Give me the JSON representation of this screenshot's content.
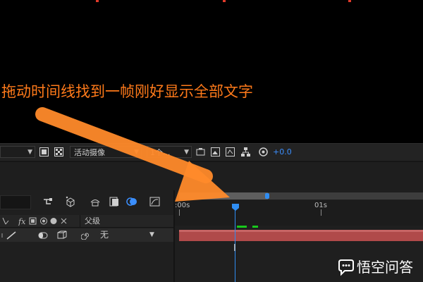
{
  "viewer": {
    "annotation": "拖动时间线找到一帧刚好显示全部文字"
  },
  "viewer_toolbar": {
    "camera_dropdown": "活动摄像",
    "views_dropdown": "1个...",
    "exposure_value": "+0.0"
  },
  "timeline": {
    "columns": {
      "parent_header": "父级"
    },
    "layer": {
      "parent_value": "无"
    },
    "ruler": {
      "start_label": ":00s",
      "second_label": "01s"
    }
  },
  "watermark": {
    "text": "悟空问答"
  },
  "colors": {
    "annotation": "#ff7a1a",
    "arrow": "#ff8a2a",
    "cti": "#2f8df2",
    "layer_bar": "#b04a4a",
    "keyframe_marker": "#18c81c",
    "exposure": "#3b8fff"
  },
  "icons": [
    "dropdown-chevron-icon",
    "region-of-interest-icon",
    "transparency-grid-icon",
    "snapshot-icon",
    "show-snapshot-icon",
    "channel-icon",
    "flowchart-icon",
    "exposure-reset-icon",
    "composition-mini-flowchart-icon",
    "draft-3d-icon",
    "shy-icon",
    "frame-blending-icon",
    "motion-blur-icon",
    "graph-editor-icon",
    "layer-solo-icon",
    "pen-icon",
    "fx-icon",
    "timeline-header-icons",
    "cube-icon",
    "spiral-icon",
    "ibeam-cursor-icon",
    "speech-bubble-icon"
  ]
}
